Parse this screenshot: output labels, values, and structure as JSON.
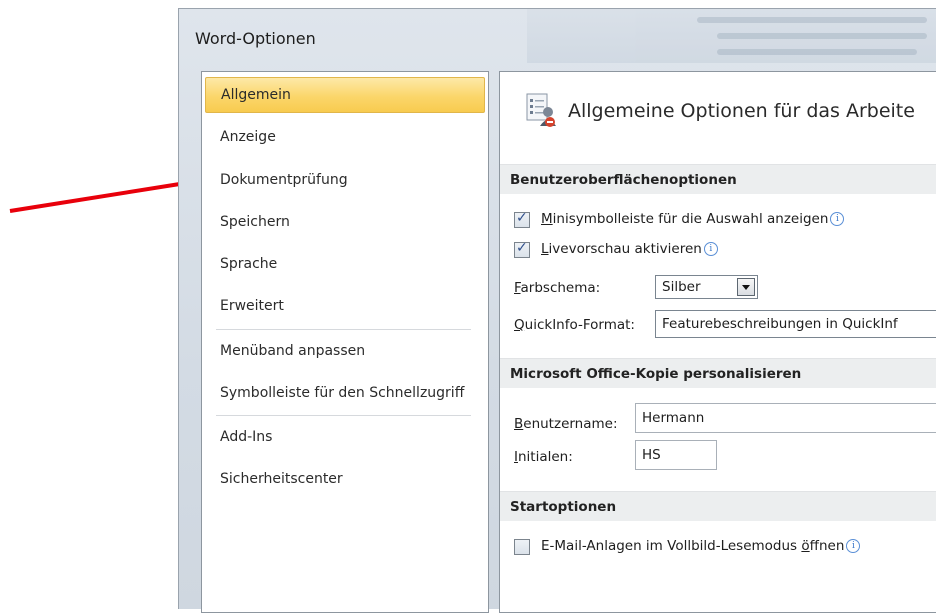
{
  "window": {
    "title": "Word-Optionen"
  },
  "nav": {
    "items": [
      {
        "label": "Allgemein",
        "selected": true
      },
      {
        "label": "Anzeige"
      },
      {
        "label": "Dokumentprüfung"
      },
      {
        "label": "Speichern"
      },
      {
        "label": "Sprache"
      },
      {
        "label": "Erweitert"
      },
      {
        "label": "Menüband anpassen"
      },
      {
        "label": "Symbolleiste für den Schnellzugriff"
      },
      {
        "label": "Add-Ins"
      },
      {
        "label": "Sicherheitscenter"
      }
    ]
  },
  "content": {
    "heading": "Allgemeine Optionen für das Arbeite",
    "ui_section": {
      "title": "Benutzeroberflächenoptionen",
      "minitoolbar": {
        "label_accel": "M",
        "label_rest": "inisymbolleiste für die Auswahl anzeigen",
        "checked": true
      },
      "livepreview": {
        "label_accel": "L",
        "label_rest": "ivevorschau aktivieren",
        "checked": true
      },
      "colorscheme": {
        "label_accel": "F",
        "label_rest": "arbschema:",
        "value": "Silber"
      },
      "screentip": {
        "label_accel": "Q",
        "label_rest": "uickInfo-Format:",
        "value": "Featurebeschreibungen in QuickInf"
      }
    },
    "office_section": {
      "title": "Microsoft Office-Kopie personalisieren",
      "username": {
        "label_accel": "B",
        "label_rest": "enutzername:",
        "value": "Hermann"
      },
      "initials": {
        "label_accel": "I",
        "label_rest": "nitialen:",
        "value": "HS"
      }
    },
    "startup_section": {
      "title": "Startoptionen",
      "email_fullscreen": {
        "label_before": "E-Mail-Anlagen im Vollbild-Lesemodus ",
        "label_accel": "ö",
        "label_after": "ffnen",
        "checked": false
      }
    }
  },
  "info_glyph": "i",
  "check_glyph": "✓",
  "colors": {
    "accent_selected": "#f8cb4f",
    "annotation_arrow": "#e8000b"
  }
}
